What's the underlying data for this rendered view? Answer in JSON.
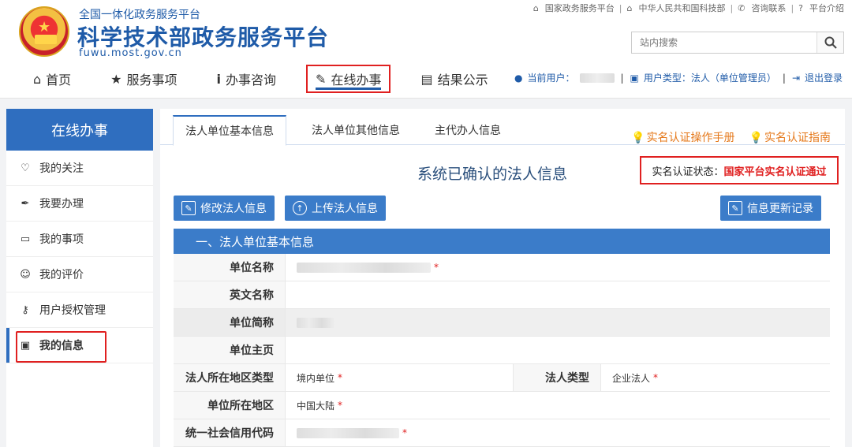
{
  "header": {
    "site_sub": "全国一体化政务服务平台",
    "site_title": "科学技术部政务服务平台",
    "site_url": "fuwu.most.gov.cn",
    "top_links": [
      "国家政务服务平台",
      "中华人民共和国科技部",
      "咨询联系",
      "平台介绍"
    ],
    "search_placeholder": "站内搜索"
  },
  "nav": {
    "items": [
      {
        "label": "首页",
        "icon": "home-icon"
      },
      {
        "label": "服务事项",
        "icon": "star-icon"
      },
      {
        "label": "办事咨询",
        "icon": "info-icon"
      },
      {
        "label": "在线办事",
        "icon": "pencil-icon",
        "active": true
      },
      {
        "label": "结果公示",
        "icon": "document-icon"
      }
    ]
  },
  "userbar": {
    "current_user_label": "当前用户：",
    "user_type_label": "用户类型：法人（单位管理员）",
    "logout": "退出登录"
  },
  "sidebar": {
    "title": "在线办事",
    "items": [
      {
        "label": "我的关注",
        "icon": "heart-icon"
      },
      {
        "label": "我要办理",
        "icon": "pen-icon"
      },
      {
        "label": "我的事项",
        "icon": "folder-icon"
      },
      {
        "label": "我的评价",
        "icon": "smile-icon"
      },
      {
        "label": "用户授权管理",
        "icon": "user-key-icon"
      },
      {
        "label": "我的信息",
        "icon": "id-card-icon",
        "active": true
      }
    ]
  },
  "main": {
    "tabs": [
      "法人单位基本信息",
      "法人单位其他信息",
      "主代办人信息"
    ],
    "guides": [
      "实名认证操作手册",
      "实名认证指南"
    ],
    "title": "系统已确认的法人信息",
    "status_label": "实名认证状态：",
    "status_value": "国家平台实名认证通过",
    "buttons": {
      "modify": "修改法人信息",
      "upload": "上传法人信息",
      "history": "信息更新记录"
    },
    "section_title": "一、法人单位基本信息",
    "fields": {
      "unit_name": "单位名称",
      "english_name": "英文名称",
      "short_name": "单位简称",
      "homepage": "单位主页",
      "region_type": "法人所在地区类型",
      "region_type_value": "境内单位",
      "legal_type": "法人类型",
      "legal_type_value": "企业法人",
      "region": "单位所在地区",
      "region_value": "中国大陆",
      "credit_code": "统一社会信用代码"
    }
  }
}
